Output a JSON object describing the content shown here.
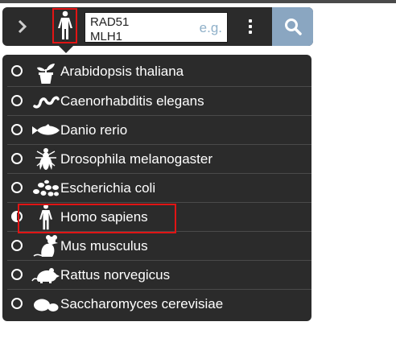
{
  "toolbar": {
    "gene_input_value": "RAD51\nMLH1",
    "gene_input_placeholder": "e.g.",
    "icons": {
      "expand": "chevron-right-icon",
      "organism": "human-figure-icon",
      "more": "kebab-menu-icon",
      "search": "search-icon"
    }
  },
  "organism_menu": {
    "selected": "Homo sapiens",
    "items": [
      {
        "label": "Arabidopsis thaliana",
        "icon": "potted-plant-icon",
        "checked": false
      },
      {
        "label": "Caenorhabditis elegans",
        "icon": "worm-icon",
        "checked": false
      },
      {
        "label": "Danio rerio",
        "icon": "fish-icon",
        "checked": false
      },
      {
        "label": "Drosophila melanogaster",
        "icon": "fly-icon",
        "checked": false
      },
      {
        "label": "Escherichia coli",
        "icon": "bacteria-icon",
        "checked": false
      },
      {
        "label": "Homo sapiens",
        "icon": "human-figure-icon",
        "checked": true
      },
      {
        "label": "Mus musculus",
        "icon": "mouse-icon",
        "checked": false
      },
      {
        "label": "Rattus norvegicus",
        "icon": "rat-icon",
        "checked": false
      },
      {
        "label": "Saccharomyces cerevisiae",
        "icon": "yeast-icon",
        "checked": false
      }
    ]
  },
  "colors": {
    "toolbar_bg": "#2b2b2b",
    "search_button": "#8aa6c1",
    "highlight": "#e11414",
    "placeholder": "#8fb0c9"
  }
}
